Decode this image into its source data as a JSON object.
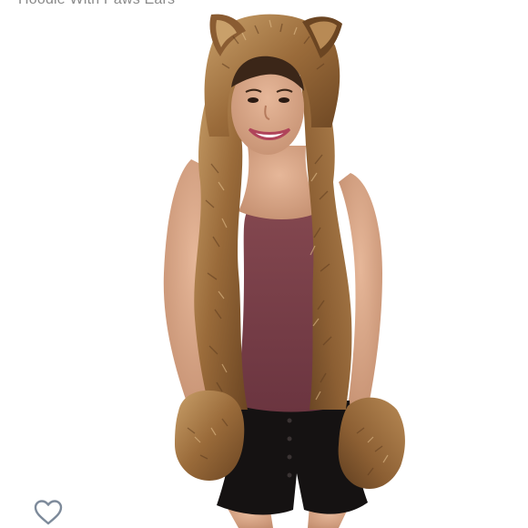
{
  "listing": {
    "title_fragment": "Hoodie With Paws Ears",
    "like_icon": "heart-outline-icon"
  },
  "colors": {
    "background": "#ffffff",
    "fur_light": "#c9a06a",
    "fur_mid": "#9a6b3a",
    "fur_dark": "#5e3d1f",
    "tank_top": "#7a3f4a",
    "shorts": "#151212",
    "skin": "#d9a98a",
    "heart_outline": "#7d8a9a"
  }
}
